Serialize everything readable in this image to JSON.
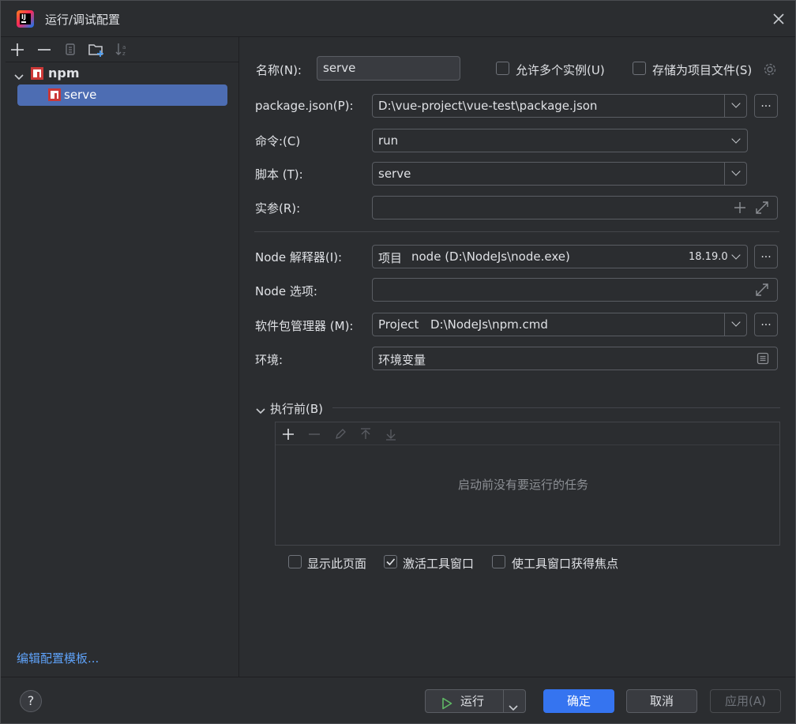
{
  "window": {
    "title": "运行/调试配置"
  },
  "tree": {
    "toolbar": [
      "add",
      "remove",
      "copy",
      "new-folder",
      "sort"
    ],
    "group": "npm",
    "item": "serve",
    "edit_templates": "编辑配置模板..."
  },
  "form": {
    "name_label": "名称(N):",
    "name_value": "serve",
    "allow_parallel": "允许多个实例(U)",
    "store_as_file": "存储为项目文件(S)",
    "package_json_label": "package.json(P):",
    "package_json_value": "D:\\vue-project\\vue-test\\package.json",
    "command_label": "命令:(C)",
    "command_value": "run",
    "scripts_label": "脚本 (T):",
    "scripts_value": "serve",
    "args_label": "实参(R):",
    "node_interp_label": "Node 解释器(I):",
    "node_interp_tag": "项目",
    "node_interp_path": "node (D:\\NodeJs\\node.exe)",
    "node_interp_version": "18.19.0",
    "node_options_label": "Node 选项:",
    "pkg_manager_label": "软件包管理器 (M):",
    "pkg_manager_tag": "Project",
    "pkg_manager_path": "D:\\NodeJs\\npm.cmd",
    "env_label": "环境:",
    "env_placeholder": "环境变量",
    "dots": "..."
  },
  "before_launch": {
    "title": "执行前(B)",
    "empty": "启动前没有要运行的任务",
    "show_page": "显示此页面",
    "activate_tool_window": "激活工具窗口",
    "activate_tool_window_checked": true,
    "focus_tool_window": "使工具窗口获得焦点"
  },
  "footer": {
    "help": "?",
    "run": "运行",
    "ok": "确定",
    "cancel": "取消",
    "apply": "应用(A)"
  },
  "colors": {
    "accent": "#3574f0",
    "selection": "#4d6db3",
    "npm_red": "#cb3837",
    "run_green": "#5fb865"
  }
}
